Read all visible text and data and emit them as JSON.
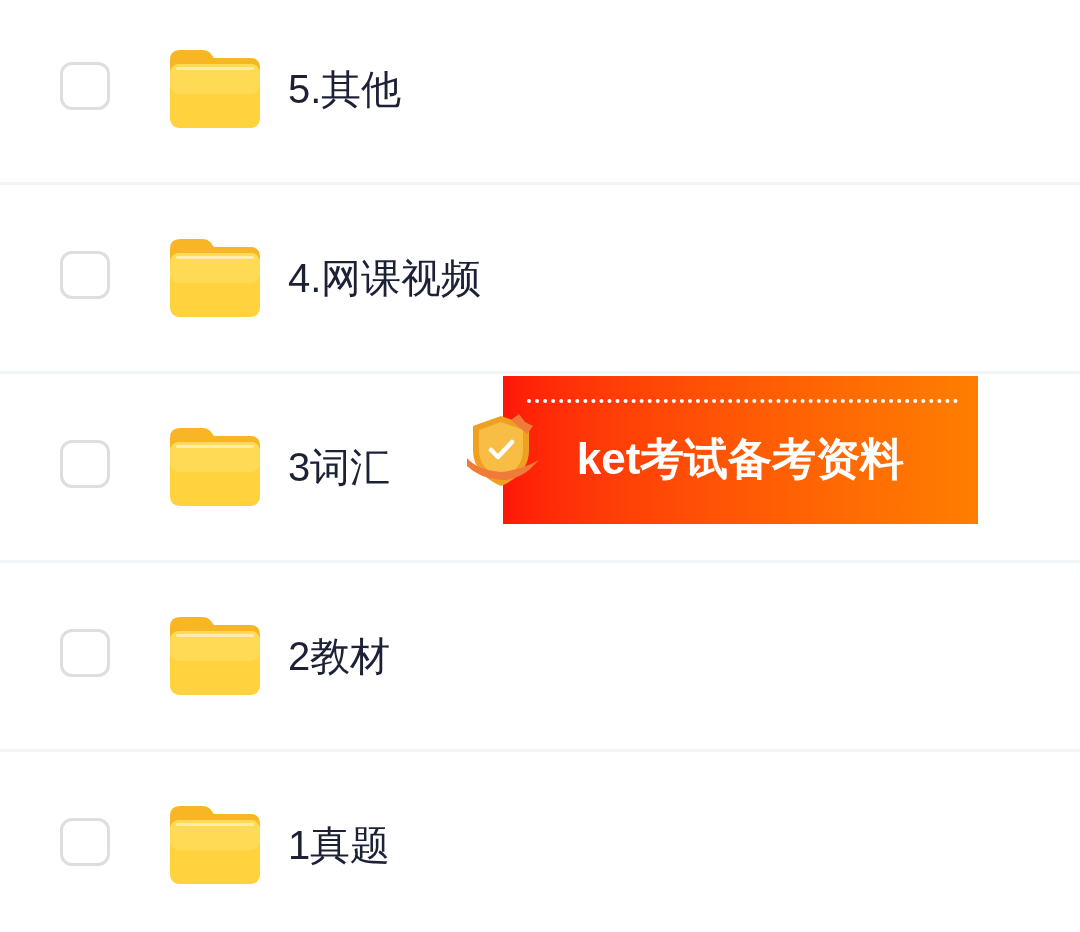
{
  "folders": [
    {
      "name": "5.其他",
      "checked": false
    },
    {
      "name": "4.网课视频",
      "checked": false
    },
    {
      "name": "3词汇",
      "checked": false
    },
    {
      "name": "2教材",
      "checked": false
    },
    {
      "name": "1真题",
      "checked": false
    }
  ],
  "banner": {
    "title": "ket考试备考资料"
  }
}
